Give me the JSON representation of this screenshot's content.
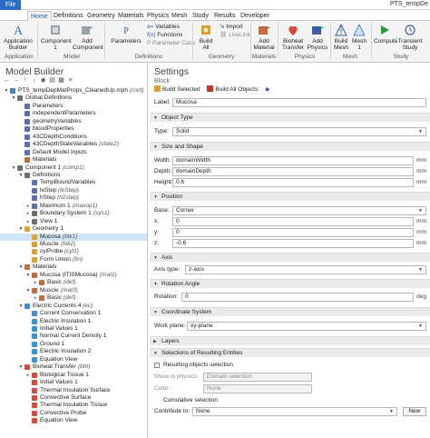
{
  "window_title": "PTS_tempDe",
  "tabs": [
    "File",
    "Home",
    "Definitions",
    "Geometry",
    "Materials",
    "Physics",
    "Mesh",
    "Study",
    "Results",
    "Developer"
  ],
  "ribbon": {
    "application_builder": "Application Builder",
    "application_group": "Application",
    "component": "Component 1",
    "add_component": "Add Component",
    "model_group": "Model",
    "parameters": "Parameters",
    "variables": "Variables",
    "functions": "Functions",
    "parameter_case": "Parameter Case",
    "definitions_group": "Definitions",
    "build_all": "Build All",
    "import": "Import",
    "livelink": "LiveLink",
    "geometry_group": "Geometry",
    "add_material": "Add Material",
    "materials_group": "Materials",
    "bioheat_transfer": "Bioheat Transfer",
    "add_physics": "Add Physics",
    "physics_group": "Physics",
    "build_mesh": "Build Mesh",
    "mesh_1": "Mesh 1",
    "mesh_group": "Mesh",
    "compute": "Compute",
    "transient_study": "Transient Study",
    "study_group": "Study"
  },
  "model_builder": {
    "title": "Model Builder",
    "tree": [
      {
        "label": "PTS_tempDepMatProps_CleanedUp.mph",
        "tag": "(root)",
        "depth": 0,
        "twisty": "▼",
        "color": "#4a7fc9"
      },
      {
        "label": "Global Definitions",
        "tag": "",
        "depth": 1,
        "twisty": "▼",
        "color": "#6e6e6e"
      },
      {
        "label": "Parameters",
        "tag": "",
        "depth": 2,
        "twisty": "",
        "color": "#5b6fb5"
      },
      {
        "label": "independentParameters",
        "tag": "",
        "depth": 2,
        "twisty": "",
        "color": "#5b6fb5"
      },
      {
        "label": "geometryVariables",
        "tag": "",
        "depth": 2,
        "twisty": "",
        "color": "#5b6fb5"
      },
      {
        "label": "bloodProperties",
        "tag": "",
        "depth": 2,
        "twisty": "",
        "color": "#5b6fb5"
      },
      {
        "label": "43CDepthConditions",
        "tag": "",
        "depth": 2,
        "twisty": "",
        "color": "#5b6fb5"
      },
      {
        "label": "43CDepthStateVariables",
        "tag": "(state2)",
        "depth": 2,
        "twisty": "",
        "color": "#5b6fb5"
      },
      {
        "label": "Default Model Inputs",
        "tag": "",
        "depth": 2,
        "twisty": "",
        "color": "#5b6fb5"
      },
      {
        "label": "Materials",
        "tag": "",
        "depth": 2,
        "twisty": "",
        "color": "#c76b3c"
      },
      {
        "label": "Component 1",
        "tag": "(comp1)",
        "depth": 1,
        "twisty": "▼",
        "color": "#6e6e6e"
      },
      {
        "label": "Definitions",
        "tag": "",
        "depth": 2,
        "twisty": "▼",
        "color": "#6e6e6e"
      },
      {
        "label": "TempBoundVariables",
        "tag": "",
        "depth": 3,
        "twisty": "",
        "color": "#5b6fb5"
      },
      {
        "label": "leStep",
        "tag": "(leStep)",
        "depth": 3,
        "twisty": "",
        "color": "#5b6fb5"
      },
      {
        "label": "hStep",
        "tag": "(h2step)",
        "depth": 3,
        "twisty": "",
        "color": "#5b6fb5"
      },
      {
        "label": "Maximum 1",
        "tag": "(maxop1)",
        "depth": 3,
        "twisty": "▸",
        "color": "#5b6fb5"
      },
      {
        "label": "Boundary System 1",
        "tag": "(sys1)",
        "depth": 3,
        "twisty": "▸",
        "color": "#6e6e6e"
      },
      {
        "label": "View 1",
        "tag": "",
        "depth": 3,
        "twisty": "▸",
        "color": "#6e6e6e"
      },
      {
        "label": "Geometry 1",
        "tag": "",
        "depth": 2,
        "twisty": "▼",
        "color": "#e0a030"
      },
      {
        "label": "Mucosa",
        "tag": "(blk1)",
        "depth": 3,
        "twisty": "",
        "color": "#e0a030",
        "selected": true
      },
      {
        "label": "Muscle",
        "tag": "(blk2)",
        "depth": 3,
        "twisty": "",
        "color": "#e0a030"
      },
      {
        "label": "cylProbe",
        "tag": "(cyl1)",
        "depth": 3,
        "twisty": "",
        "color": "#e0a030"
      },
      {
        "label": "Form Union",
        "tag": "(fin)",
        "depth": 3,
        "twisty": "",
        "color": "#e0a030"
      },
      {
        "label": "Materials",
        "tag": "",
        "depth": 2,
        "twisty": "▼",
        "color": "#c76b3c"
      },
      {
        "label": "Mucosa (ITISMucosa)",
        "tag": "(mat1)",
        "depth": 3,
        "twisty": "▼",
        "color": "#c76b3c"
      },
      {
        "label": "Basic",
        "tag": "(def)",
        "depth": 4,
        "twisty": "▸",
        "color": "#c76b3c"
      },
      {
        "label": "Muscle",
        "tag": "(mat3)",
        "depth": 3,
        "twisty": "▼",
        "color": "#c76b3c"
      },
      {
        "label": "Basic",
        "tag": "(def)",
        "depth": 4,
        "twisty": "▸",
        "color": "#c76b3c"
      },
      {
        "label": "Electric Currents 4",
        "tag": "(ec)",
        "depth": 2,
        "twisty": "▼",
        "color": "#3c8fd9"
      },
      {
        "label": "Current Conservation 1",
        "tag": "",
        "depth": 3,
        "twisty": "",
        "color": "#3c8fd9"
      },
      {
        "label": "Electric Insulation 1",
        "tag": "",
        "depth": 3,
        "twisty": "",
        "color": "#3c8fd9"
      },
      {
        "label": "Initial Values 1",
        "tag": "",
        "depth": 3,
        "twisty": "",
        "color": "#3c8fd9"
      },
      {
        "label": "Normal Current Density 1",
        "tag": "",
        "depth": 3,
        "twisty": "",
        "color": "#3c8fd9"
      },
      {
        "label": "Ground 1",
        "tag": "",
        "depth": 3,
        "twisty": "",
        "color": "#3c8fd9"
      },
      {
        "label": "Electric Insulation 2",
        "tag": "",
        "depth": 3,
        "twisty": "",
        "color": "#3c8fd9"
      },
      {
        "label": "Equation View",
        "tag": "",
        "depth": 3,
        "twisty": "",
        "color": "#3c8fd9"
      },
      {
        "label": "Bioheat Transfer",
        "tag": "(bht)",
        "depth": 2,
        "twisty": "▼",
        "color": "#d94a3c"
      },
      {
        "label": "Biological Tissue 1",
        "tag": "",
        "depth": 3,
        "twisty": "▸",
        "color": "#d94a3c"
      },
      {
        "label": "Initial Values 1",
        "tag": "",
        "depth": 3,
        "twisty": "",
        "color": "#d94a3c"
      },
      {
        "label": "Thermal Insulation Surface",
        "tag": "",
        "depth": 3,
        "twisty": "",
        "color": "#d94a3c"
      },
      {
        "label": "Convective Surface",
        "tag": "",
        "depth": 3,
        "twisty": "",
        "color": "#d94a3c"
      },
      {
        "label": "Thermal Insulation Tissue",
        "tag": "",
        "depth": 3,
        "twisty": "",
        "color": "#d94a3c"
      },
      {
        "label": "Convective Probe",
        "tag": "",
        "depth": 3,
        "twisty": "",
        "color": "#d94a3c"
      },
      {
        "label": "Equation View",
        "tag": "",
        "depth": 3,
        "twisty": "",
        "color": "#d94a3c"
      }
    ]
  },
  "settings": {
    "title": "Settings",
    "subtitle": "Block",
    "build_selected": "Build Selected",
    "build_all_objects": "Build All Objects",
    "label_caption": "Label:",
    "label_value": "Mucosa",
    "object_type_section": "Object Type",
    "type_caption": "Type:",
    "type_value": "Solid",
    "size_section": "Size and Shape",
    "width_caption": "Width:",
    "width_value": "domainWidth",
    "depth_caption": "Depth:",
    "depth_value": "domainDepth",
    "height_caption": "Height:",
    "height_value": "0.6",
    "unit_mm": "mm",
    "position_section": "Position",
    "base_caption": "Base:",
    "base_value": "Corner",
    "x_caption": "x:",
    "x_value": "0",
    "y_caption": "y:",
    "y_value": "0",
    "z_caption": "z:",
    "z_value": "-0.6",
    "axis_section": "Axis",
    "axis_type_caption": "Axis type:",
    "axis_type_value": "z-axis",
    "rotation_section": "Rotation Angle",
    "rotation_caption": "Rotation:",
    "rotation_value": "0",
    "unit_deg": "deg",
    "coord_section": "Coordinate System",
    "work_plane_caption": "Work plane:",
    "work_plane_value": "xy-plane",
    "layers_section": "Layers",
    "selections_section": "Selections of Resulting Entities",
    "resulting_objects_selection": "Resulting objects selection",
    "show_in_physics_caption": "Show in physics:",
    "show_in_physics_value": "Domain selection",
    "color_caption": "Color:",
    "color_value": "None",
    "cumulative_selection": "Cumulative selection",
    "contribute_caption": "Contribute to:",
    "contribute_value": "None",
    "new_button": "New"
  }
}
